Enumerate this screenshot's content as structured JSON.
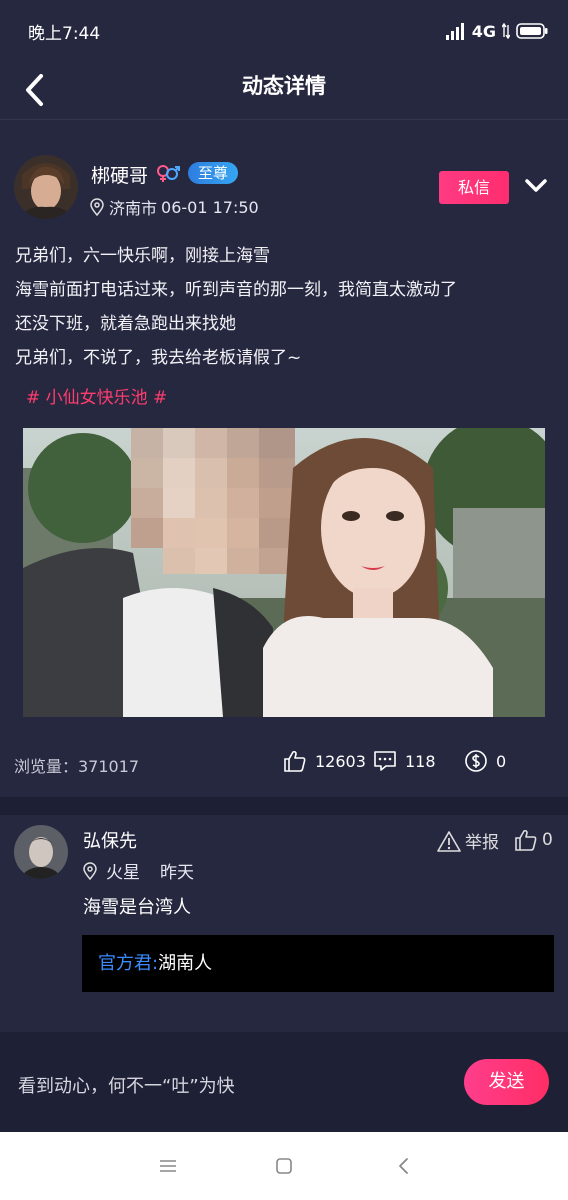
{
  "status_bar": {
    "time": "晚上7:44",
    "network": "4G"
  },
  "header": {
    "title": "动态详情"
  },
  "post": {
    "author": {
      "name": "梆硬哥",
      "badge": "至尊",
      "location": "济南市",
      "datetime": "06-01 17:50"
    },
    "dm_label": "私信",
    "text_lines": [
      "兄弟们，六一快乐啊，刚接上海雪",
      "海雪前面打电话过来，听到声音的那一刻，我简直太激动了",
      "还没下班，就着急跑出来找她",
      "兄弟们，不说了，我去给老板请假了~"
    ],
    "topic": "# 小仙女快乐池 #",
    "views_label": "浏览量：371017",
    "likes": "12603",
    "comments": "118",
    "tips": "0"
  },
  "comment": {
    "name": "弘保先",
    "location": "火星",
    "time": "昨天",
    "report_label": "举报",
    "likes": "0",
    "text": "海雪是台湾人",
    "reply": {
      "author": "官方君:",
      "text": "湖南人"
    }
  },
  "input_bar": {
    "placeholder": "看到动心，何不一“吐”为快",
    "send_label": "发送"
  },
  "colors": {
    "background": "#262840",
    "accent_pink": "#ff2d6f",
    "badge_blue": "#36a6f2",
    "link_blue": "#3a8cff"
  }
}
